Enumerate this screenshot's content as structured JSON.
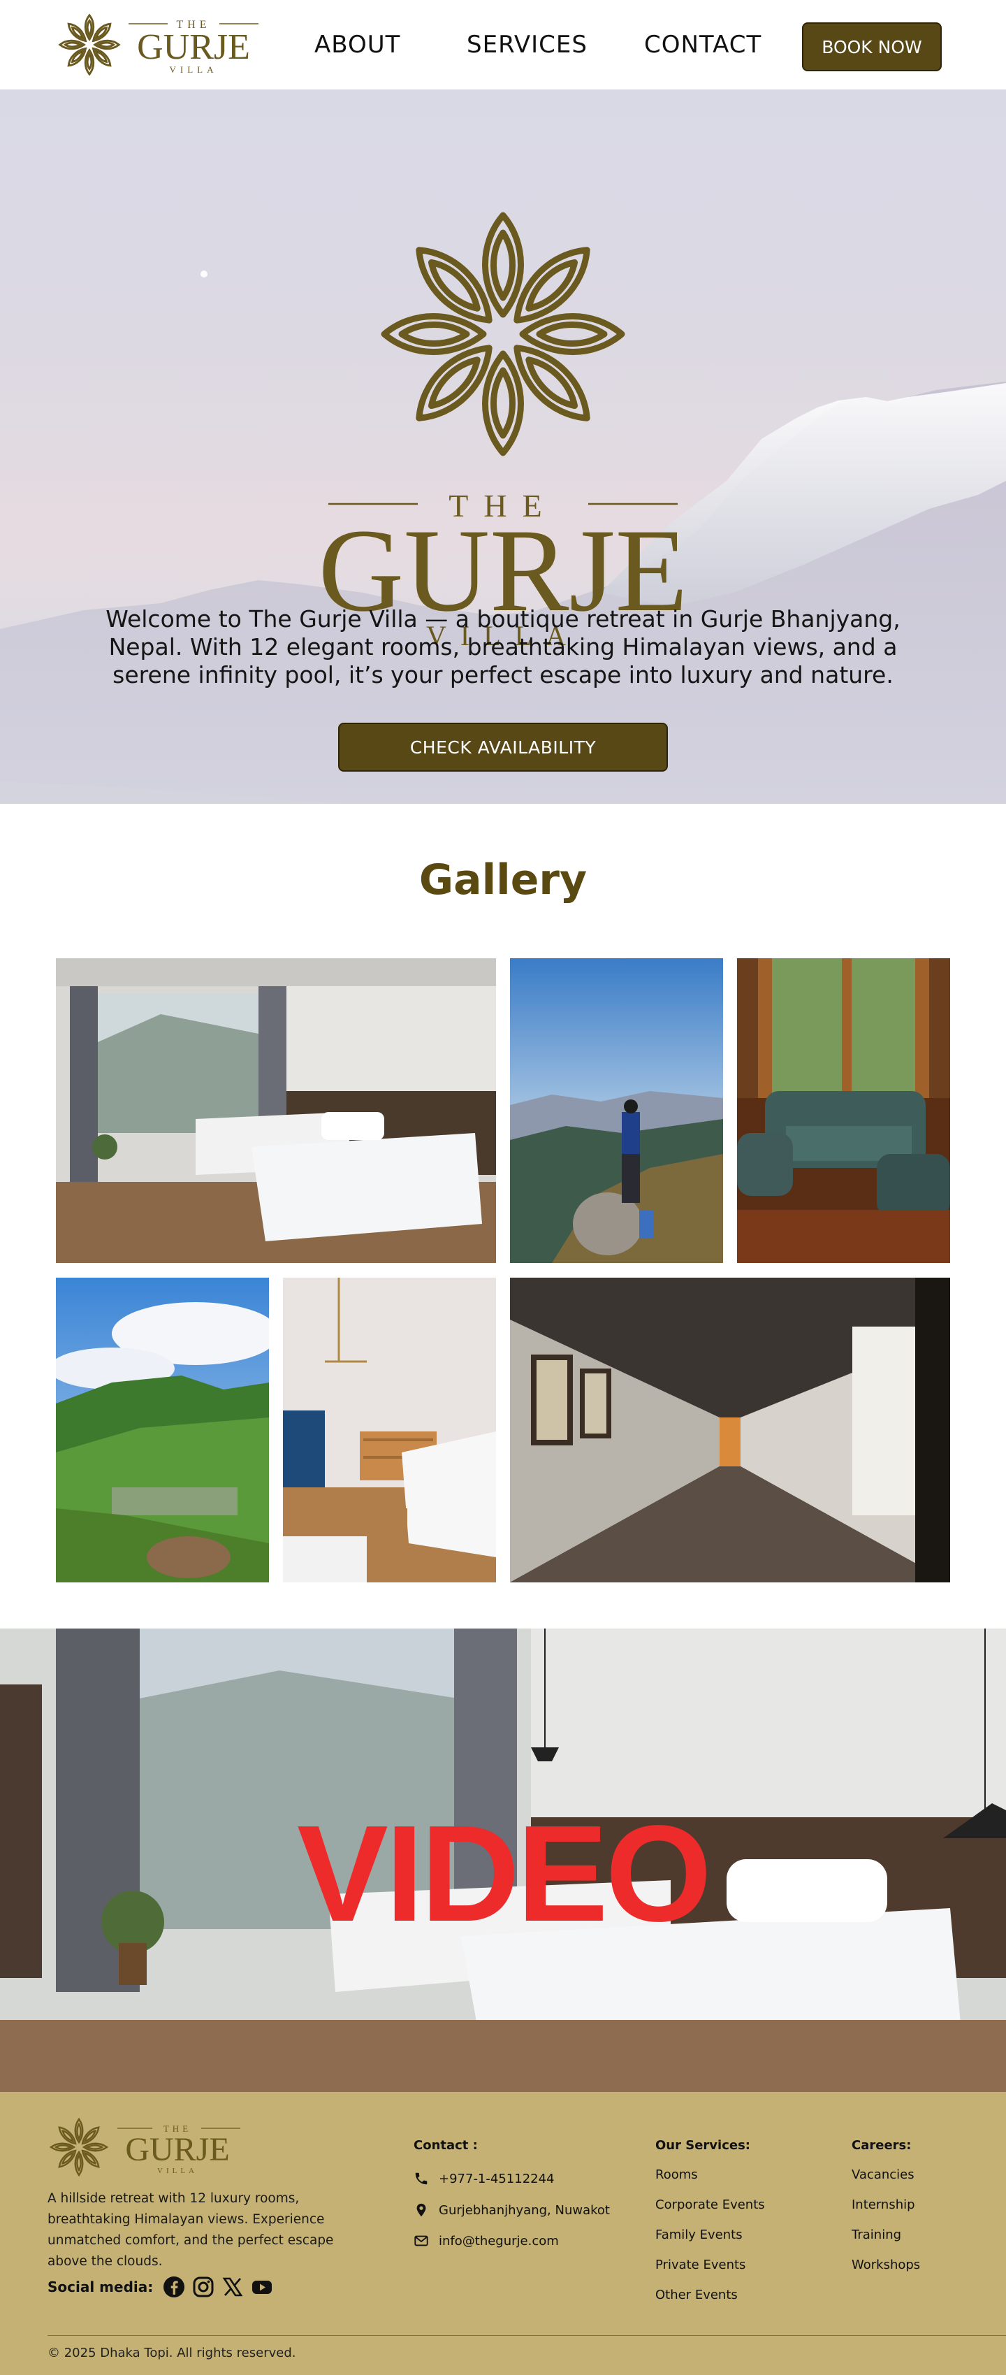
{
  "nav": {
    "logo": {
      "the": "THE",
      "name": "GURJE",
      "villa": "VILLA"
    },
    "links": [
      {
        "label": "ABOUT"
      },
      {
        "label": "SERVICES"
      },
      {
        "label": "CONTACT"
      }
    ],
    "book_label": "BOOK NOW"
  },
  "hero": {
    "logo": {
      "the": "THE",
      "name": "GURJE",
      "villa": "VILLA"
    },
    "text": "Welcome to The Gurje Villa — a boutique retreat in Gurje Bhanjyang, Nepal. With 12 elegant rooms, breathtaking Himalayan views, and a serene infinity pool, it’s your perfect escape into luxury and nature.",
    "cta_label": "CHECK AVAILABILITY"
  },
  "gallery": {
    "title": "Gallery",
    "photos": [
      {
        "name": "twin-bedroom-photo"
      },
      {
        "name": "hiker-on-ridge-photo"
      },
      {
        "name": "lounge-seating-photo"
      },
      {
        "name": "green-valley-photo"
      },
      {
        "name": "bedroom-dresser-photo"
      },
      {
        "name": "hallway-corridor-photo"
      }
    ]
  },
  "video": {
    "label": "VIDEO"
  },
  "footer": {
    "logo": {
      "the": "THE",
      "name": "GURJE",
      "villa": "VILLA"
    },
    "description": "A hillside retreat with 12 luxury rooms, breathtaking Himalayan views. Experience unmatched comfort, and the perfect escape above the clouds.",
    "social_label": "Social media:",
    "social_icons": [
      "facebook-icon",
      "instagram-icon",
      "x-icon",
      "youtube-icon"
    ],
    "contact": {
      "title": "Contact :",
      "phone": "+977-1-45112244",
      "address": "Gurjebhanjhyang, Nuwakot",
      "email": "info@thegurje.com"
    },
    "services": {
      "title": "Our Services:",
      "items": [
        "Rooms",
        "Corporate Events",
        "Family Events",
        "Private Events",
        "Other Events"
      ]
    },
    "careers": {
      "title": "Careers:",
      "items": [
        "Vacancies",
        "Internship",
        "Training",
        "Workshops"
      ]
    },
    "copyright": "© 2025 Dhaka Topi. All rights reserved."
  },
  "colors": {
    "brand_brown": "#574815",
    "logo_gold": "#6b5a1f",
    "footer_bg": "#c4b173",
    "video_text": "#ee2b2b"
  }
}
